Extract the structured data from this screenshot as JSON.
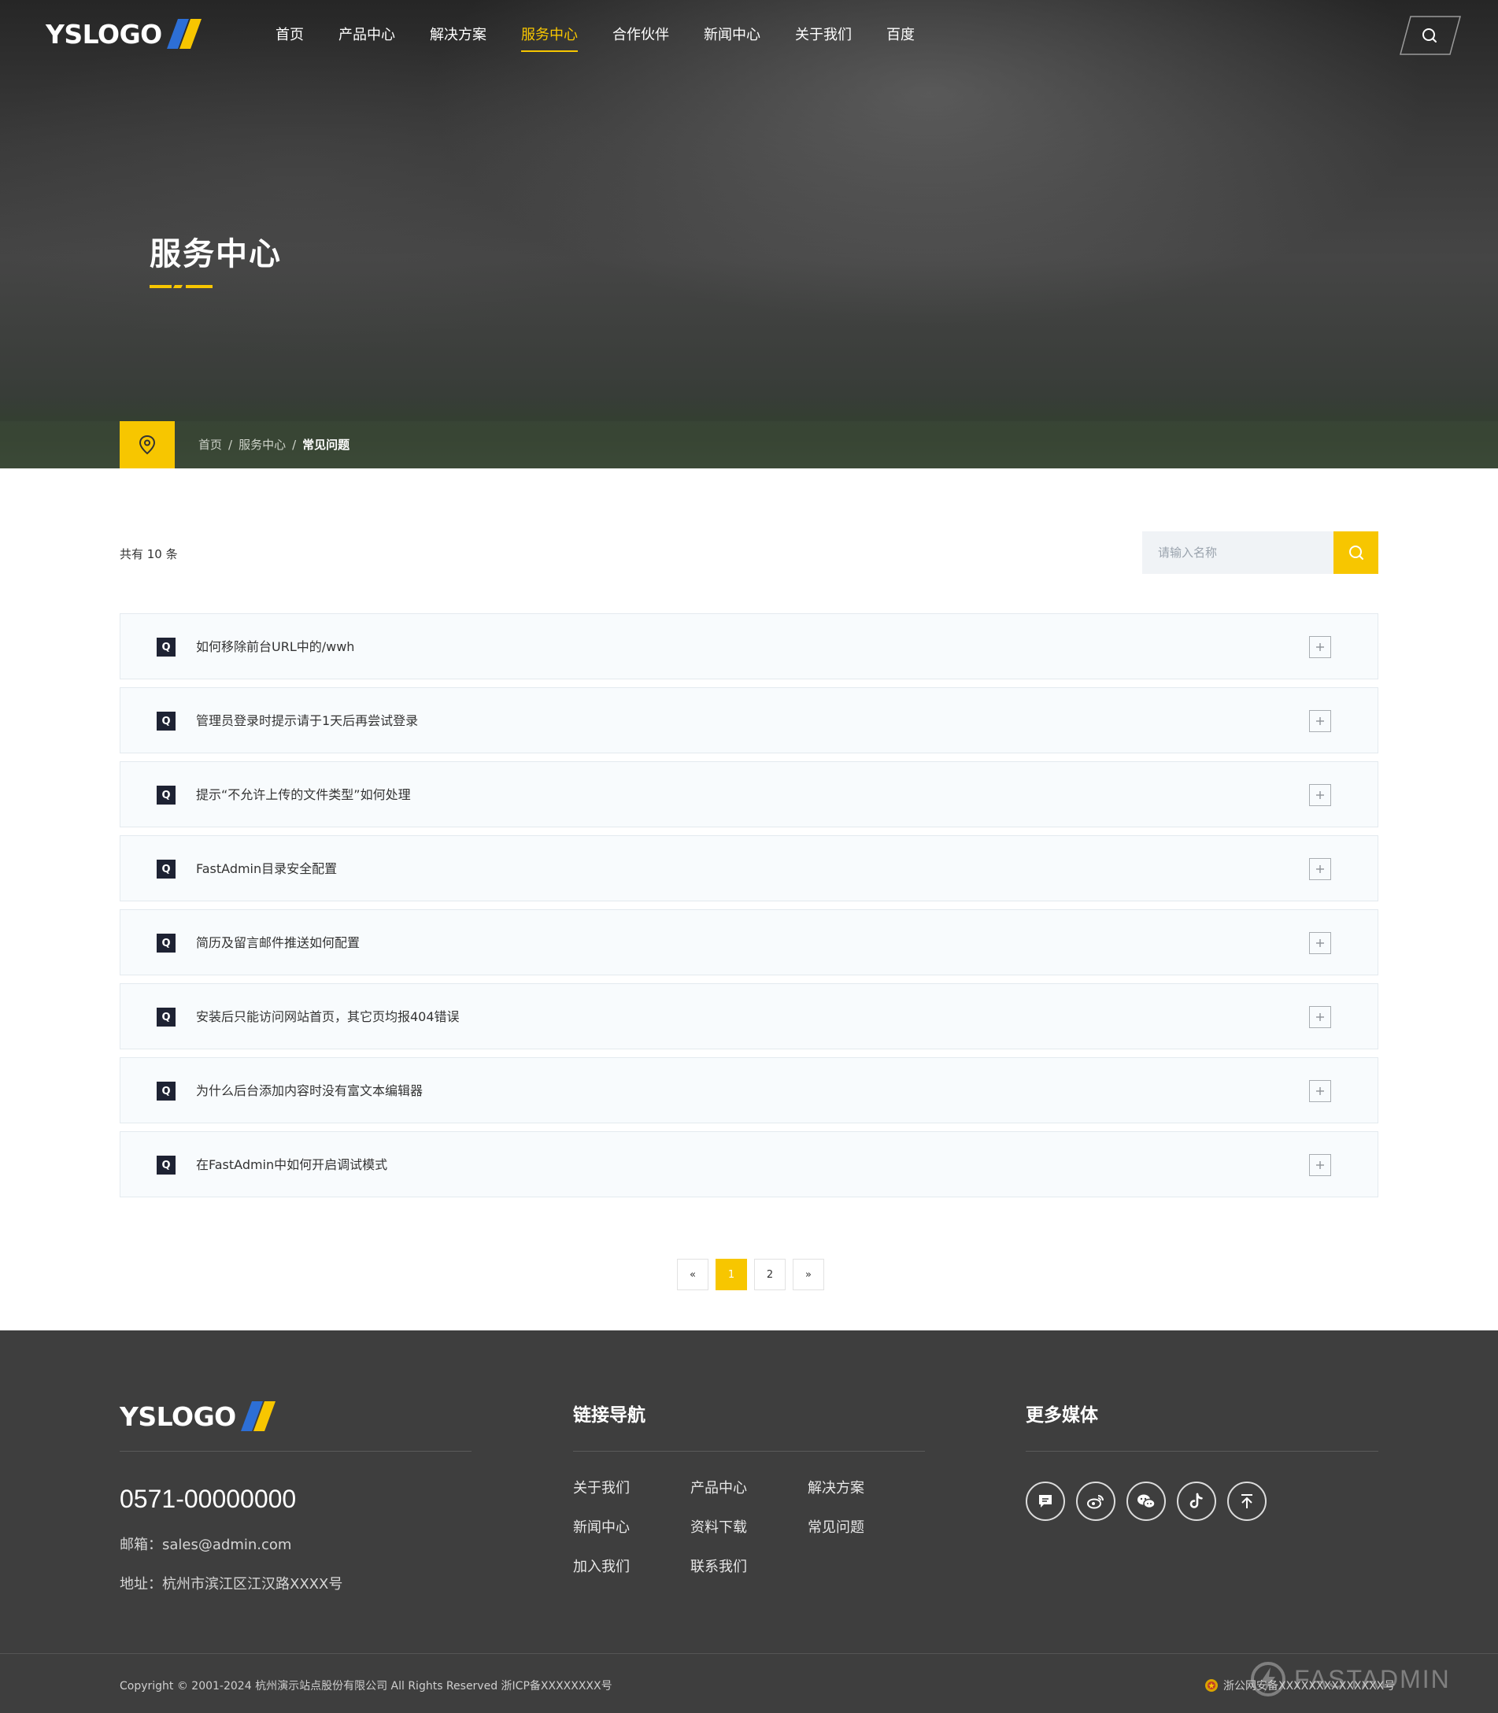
{
  "header": {
    "logo_text": "YSLOGO",
    "nav": [
      {
        "label": "首页",
        "active": false
      },
      {
        "label": "产品中心",
        "active": false
      },
      {
        "label": "解决方案",
        "active": false
      },
      {
        "label": "服务中心",
        "active": true
      },
      {
        "label": "合作伙伴",
        "active": false
      },
      {
        "label": "新闻中心",
        "active": false
      },
      {
        "label": "关于我们",
        "active": false
      },
      {
        "label": "百度",
        "active": false
      }
    ],
    "search_icon": "search-icon"
  },
  "hero": {
    "title": "服务中心"
  },
  "breadcrumb": {
    "icon": "location-pin-icon",
    "items": [
      "首页",
      "服务中心",
      "常见问题"
    ],
    "separator": "/"
  },
  "list": {
    "total_text": "共有 10 条",
    "search_placeholder": "请输入名称",
    "faqs": [
      {
        "badge": "Q",
        "question": "如何移除前台URL中的/wwh"
      },
      {
        "badge": "Q",
        "question": "管理员登录时提示请于1天后再尝试登录"
      },
      {
        "badge": "Q",
        "question": "提示“不允许上传的文件类型”如何处理"
      },
      {
        "badge": "Q",
        "question": "FastAdmin目录安全配置"
      },
      {
        "badge": "Q",
        "question": "简历及留言邮件推送如何配置"
      },
      {
        "badge": "Q",
        "question": "安装后只能访问网站首页，其它页均报404错误"
      },
      {
        "badge": "Q",
        "question": "为什么后台添加内容时没有富文本编辑器"
      },
      {
        "badge": "Q",
        "question": "在FastAdmin中如何开启调试模式"
      }
    ]
  },
  "pagination": {
    "prev": "«",
    "pages": [
      "1",
      "2"
    ],
    "current": "1",
    "next": "»"
  },
  "footer": {
    "logo_text": "YSLOGO",
    "phone": "0571-00000000",
    "email": "邮箱：sales@admin.com",
    "address": "地址：杭州市滨江区江汉路XXXX号",
    "links_heading": "链接导航",
    "links": [
      "关于我们",
      "产品中心",
      "解决方案",
      "新闻中心",
      "资料下载",
      "常见问题",
      "加入我们",
      "联系我们"
    ],
    "media_heading": "更多媒体",
    "media_icons": [
      "message-icon",
      "weibo-icon",
      "wechat-icon",
      "tiktok-icon",
      "back-to-top-icon"
    ],
    "copyright": "Copyright © 2001-2024 杭州演示站点股份有限公司 All Rights Reserved 浙ICP备XXXXXXXX号",
    "police": "浙公网安备XXXXXXXXXXXXXX号",
    "watermark": "FASTADMIN"
  },
  "colors": {
    "accent": "#f7c600",
    "logo_blue": "#2d6fd6",
    "badge_dark": "#1e2233",
    "footer_bg": "#3e3e3e"
  }
}
